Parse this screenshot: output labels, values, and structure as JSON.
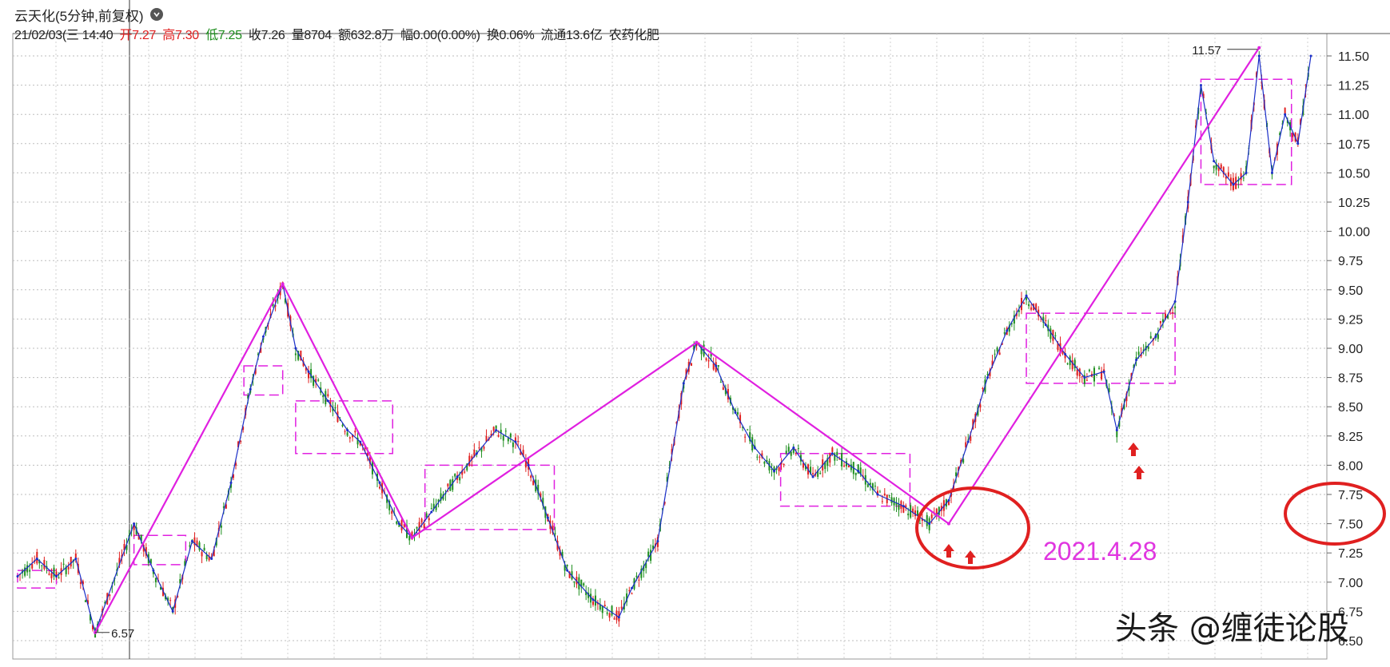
{
  "title": "云天化(5分钟,前复权)",
  "info": {
    "date": "21/02/03(三 14:40",
    "open_label": "开7.27",
    "high_label": "高7.30",
    "low_label": "低7.25",
    "close_label": "收7.26",
    "volume_label": "量8704",
    "amount_label": "额632.8万",
    "change_label": "幅0.00(0.00%)",
    "turnover_label": "换0.06%",
    "float_label": "流通13.6亿",
    "sector_label": "农药化肥"
  },
  "annotations": {
    "date": "2021.4.28",
    "watermark": "头条 @缠徒论股",
    "low_marker": "6.57",
    "high_marker": "11.57"
  },
  "colors": {
    "up": "#e02020",
    "down": "#1f8f1f",
    "pen": "#1a2ec8",
    "segment": "#e020e0",
    "circle": "#e02020"
  },
  "chart_data": {
    "type": "line",
    "title": "",
    "xlabel": "",
    "ylabel": "",
    "ylim": [
      6.5,
      11.6
    ],
    "yticks": [
      "11.50",
      "11.25",
      "11.00",
      "10.75",
      "10.50",
      "10.25",
      "10.00",
      "9.75",
      "9.50",
      "9.25",
      "9.00",
      "8.75",
      "8.50",
      "8.25",
      "8.00",
      "7.75",
      "7.50",
      "7.25",
      "7.00",
      "6.75",
      "6.50"
    ],
    "grid": true,
    "x_range": [
      0,
      100
    ],
    "series": [
      {
        "values": [
          [
            0,
            7.05
          ],
          [
            1.5,
            7.2
          ],
          [
            3,
            7.05
          ],
          [
            4.5,
            7.2
          ],
          [
            6,
            6.57
          ],
          [
            9,
            7.5
          ],
          [
            10.5,
            7.1
          ],
          [
            12,
            6.75
          ],
          [
            13.5,
            7.35
          ],
          [
            15,
            7.2
          ],
          [
            16.5,
            7.85
          ],
          [
            18,
            8.65
          ],
          [
            19,
            9.1
          ],
          [
            20.5,
            9.55
          ],
          [
            21.5,
            9.0
          ],
          [
            22.5,
            8.8
          ],
          [
            24,
            8.55
          ],
          [
            25.5,
            8.3
          ],
          [
            26.5,
            8.2
          ],
          [
            28,
            7.85
          ],
          [
            29.5,
            7.5
          ],
          [
            30.5,
            7.38
          ],
          [
            32,
            7.6
          ],
          [
            34,
            7.9
          ],
          [
            35.5,
            8.1
          ],
          [
            37,
            8.3
          ],
          [
            38.5,
            8.2
          ],
          [
            39.5,
            8.0
          ],
          [
            41,
            7.55
          ],
          [
            42.5,
            7.1
          ],
          [
            44.5,
            6.85
          ],
          [
            46.5,
            6.7
          ],
          [
            47.5,
            6.95
          ],
          [
            49.5,
            7.35
          ],
          [
            51.5,
            8.7
          ],
          [
            52.5,
            9.05
          ],
          [
            54,
            8.85
          ],
          [
            55.5,
            8.45
          ],
          [
            57,
            8.15
          ],
          [
            58.5,
            7.95
          ],
          [
            60,
            8.15
          ],
          [
            61.5,
            7.9
          ],
          [
            63,
            8.1
          ],
          [
            65,
            7.95
          ],
          [
            66.5,
            7.75
          ],
          [
            68.5,
            7.65
          ],
          [
            70.5,
            7.5
          ],
          [
            72,
            7.7
          ],
          [
            73.5,
            8.2
          ],
          [
            75,
            8.75
          ],
          [
            76.5,
            9.15
          ],
          [
            78,
            9.45
          ],
          [
            79.5,
            9.2
          ],
          [
            81,
            8.95
          ],
          [
            82.5,
            8.75
          ],
          [
            84,
            8.8
          ],
          [
            85,
            8.3
          ],
          [
            86.5,
            8.9
          ],
          [
            88,
            9.1
          ],
          [
            89.5,
            9.4
          ],
          [
            90.5,
            10.25
          ],
          [
            91.5,
            11.25
          ],
          [
            92.5,
            10.6
          ],
          [
            94,
            10.4
          ],
          [
            95,
            10.5
          ],
          [
            96,
            11.5
          ],
          [
            97,
            10.5
          ],
          [
            98,
            11.0
          ],
          [
            99,
            10.75
          ],
          [
            100,
            11.5
          ]
        ]
      },
      {
        "values": [
          [
            6,
            6.57
          ],
          [
            20.5,
            9.55
          ],
          [
            30.5,
            7.38
          ],
          [
            52.5,
            9.05
          ],
          [
            72,
            7.5
          ],
          [
            96,
            11.57
          ]
        ]
      }
    ],
    "zones": [
      {
        "x0": 0,
        "x1": 3,
        "y0": 6.95,
        "y1": 7.1
      },
      {
        "x0": 9,
        "x1": 13,
        "y0": 7.15,
        "y1": 7.4
      },
      {
        "x0": 17.5,
        "x1": 20.5,
        "y0": 8.6,
        "y1": 8.85
      },
      {
        "x0": 21.5,
        "x1": 29,
        "y0": 8.1,
        "y1": 8.55
      },
      {
        "x0": 31.5,
        "x1": 41.5,
        "y0": 7.45,
        "y1": 8.0
      },
      {
        "x0": 59,
        "x1": 69,
        "y0": 7.65,
        "y1": 8.1
      },
      {
        "x0": 78,
        "x1": 89.5,
        "y0": 8.7,
        "y1": 9.3
      },
      {
        "x0": 91.5,
        "x1": 98.5,
        "y0": 10.4,
        "y1": 11.3
      }
    ]
  }
}
